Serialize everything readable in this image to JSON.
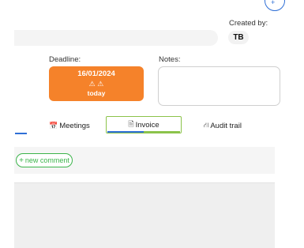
{
  "header": {
    "created_label": "Created by:",
    "creator_initials": "TB",
    "corner_button_icon": "add-icon",
    "corner_button_glyph": "+"
  },
  "deadline": {
    "label": "Deadline:",
    "date": "16/01/2024",
    "warning_icons": "⚠ ⚠",
    "relative": "today",
    "color": "#f5822a"
  },
  "notes": {
    "label": "Notes:",
    "value": ""
  },
  "tabs": [
    {
      "label": "Meetings",
      "icon": "calendar-icon",
      "glyph": "📅",
      "active": false
    },
    {
      "label": "Invoice",
      "icon": "document-icon",
      "glyph": "🗎",
      "active": true
    },
    {
      "label": "Audit trail",
      "icon": "audit-trail-icon",
      "glyph": "⛙",
      "active": false
    }
  ],
  "comments": {
    "new_comment_label": "new comment",
    "new_comment_icon": "plus-icon",
    "new_comment_glyph": "+"
  },
  "colors": {
    "accent_blue": "#2f6fd6",
    "accent_green": "#3cb44b"
  }
}
